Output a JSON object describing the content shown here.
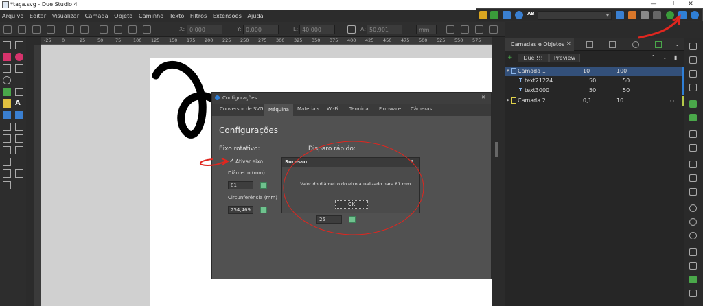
{
  "window": {
    "title": "*taça.svg - Due Studio 4",
    "minimize": "—",
    "maximize": "❐",
    "close": "✕"
  },
  "menu": [
    "Arquivo",
    "Editar",
    "Visualizar",
    "Camada",
    "Objeto",
    "Caminho",
    "Texto",
    "Filtros",
    "Extensões",
    "Ajuda"
  ],
  "controls": {
    "x_label": "X:",
    "x_value": "0,000",
    "y_label": "Y:",
    "y_value": "0,000",
    "l_label": "L:",
    "l_value": "40,000",
    "a_label": "A:",
    "a_value": "50,901",
    "unit": "mm"
  },
  "ruler": [
    "-25",
    "0",
    "25",
    "50",
    "75",
    "100",
    "125",
    "150",
    "175",
    "200",
    "225",
    "250",
    "275",
    "300",
    "325",
    "350",
    "375",
    "400",
    "425",
    "450",
    "475",
    "500",
    "525",
    "550",
    "575"
  ],
  "top_toolbar": {
    "ab_label": "AB"
  },
  "layers_panel": {
    "tab_title": "Camadas e Objetos",
    "button_due": "Due !!!",
    "button_preview": "Preview",
    "rows": [
      {
        "name": "Camada 1",
        "v1": "10",
        "v2": "100",
        "selected": true
      },
      {
        "name": "text21224",
        "v1": "50",
        "v2": "50",
        "selected": false
      },
      {
        "name": "text3000",
        "v1": "50",
        "v2": "50",
        "selected": false
      },
      {
        "name": "Camada 2",
        "v1": "0,1",
        "v2": "10",
        "selected": false
      }
    ]
  },
  "config_dialog": {
    "title": "Configurações",
    "close": "✕",
    "tabs": [
      "Conversor de SVG",
      "Máquina",
      "Materiais",
      "Wi-Fi",
      "Terminal",
      "Firmware",
      "Câmeras"
    ],
    "active_tab": "Máquina",
    "heading": "Configurações",
    "rotary": {
      "section": "Eixo rotativo:",
      "enable_label": "Ativar eixo",
      "diameter_label": "Diâmetro (mm)",
      "diameter_value": "81",
      "circumference_label": "Circunferência (mm)",
      "circumference_value": "254,469"
    },
    "fast_shot": {
      "section": "Disparo rápido:",
      "value": "25"
    }
  },
  "success_dialog": {
    "title": "Sucesso",
    "close": "✕",
    "message": "Valor do diâmetro do eixo atualizado para 81 mm.",
    "ok": "OK"
  },
  "colors": {
    "accent_blue": "#2f7fd6",
    "selected_row": "#33507a",
    "annotation_red": "#e0261f",
    "check_green": "#6fc28e"
  }
}
